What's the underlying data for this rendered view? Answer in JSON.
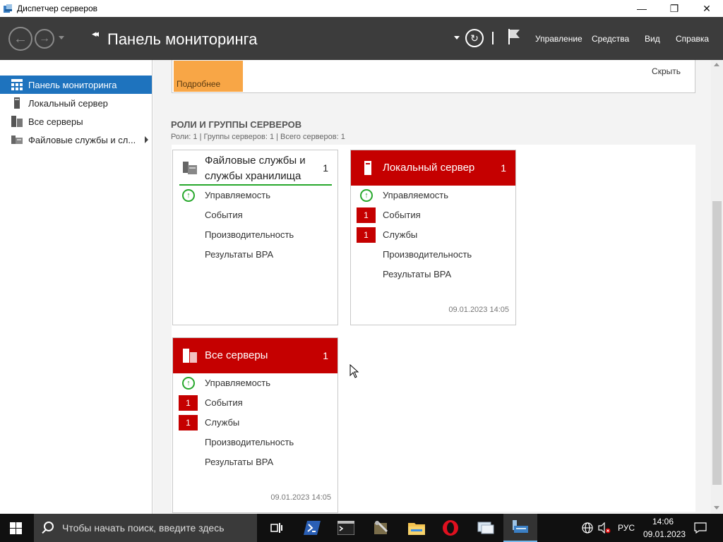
{
  "window": {
    "title": "Диспетчер серверов",
    "controls": {
      "minimize": "—",
      "restore": "❐",
      "close": "✕"
    }
  },
  "header": {
    "page_title": "Панель мониторинга",
    "crumb_arrows": "◂◂",
    "menu": [
      "Управление",
      "Средства",
      "Вид",
      "Справка"
    ]
  },
  "sidebar": {
    "items": [
      {
        "label": "Панель мониторинга",
        "icon": "dashboard-icon",
        "active": true
      },
      {
        "label": "Локальный сервер",
        "icon": "server-icon"
      },
      {
        "label": "Все серверы",
        "icon": "servers-icon"
      },
      {
        "label": "Файловые службы и сл...",
        "icon": "file-services-icon",
        "has_arrow": true
      }
    ]
  },
  "welcome": {
    "more_label": "Подробнее",
    "hide_label": "Скрыть"
  },
  "roles": {
    "title": "РОЛИ И ГРУППЫ СЕРВЕРОВ",
    "subtitle": "Роли: 1 | Группы серверов: 1 | Всего серверов: 1"
  },
  "tiles": [
    {
      "title_line1": "Файловые службы и",
      "title_line2": "службы хранилища",
      "count": "1",
      "rows": [
        {
          "label": "Управляемость",
          "status": "ok"
        },
        {
          "label": "События"
        },
        {
          "label": "Производительность"
        },
        {
          "label": "Результаты BPA"
        }
      ]
    },
    {
      "title": "Локальный сервер",
      "count": "1",
      "rows": [
        {
          "label": "Управляемость",
          "status": "ok"
        },
        {
          "label": "События",
          "badge": "1"
        },
        {
          "label": "Службы",
          "badge": "1"
        },
        {
          "label": "Производительность"
        },
        {
          "label": "Результаты BPA"
        }
      ],
      "date": "09.01.2023 14:05"
    },
    {
      "title": "Все серверы",
      "count": "1",
      "rows": [
        {
          "label": "Управляемость",
          "status": "ok"
        },
        {
          "label": "События",
          "badge": "1"
        },
        {
          "label": "Службы",
          "badge": "1"
        },
        {
          "label": "Производительность"
        },
        {
          "label": "Результаты BPA"
        }
      ],
      "date": "09.01.2023 14:05"
    }
  ],
  "taskbar": {
    "search_placeholder": "Чтобы начать поиск, введите здесь",
    "apps": [
      "task-view-icon",
      "powershell-icon",
      "cmd-icon",
      "tools-icon",
      "explorer-icon",
      "opera-icon",
      "remote-desktop-icon",
      "server-manager-icon"
    ],
    "language": "РУС",
    "time": "14:06",
    "date": "09.01.2023"
  },
  "colors": {
    "accent": "#1e73be",
    "alert_red": "#c50000",
    "ok_green": "#27a82c",
    "header_bg": "#3c3c3c",
    "more_orange": "#f8a646"
  }
}
